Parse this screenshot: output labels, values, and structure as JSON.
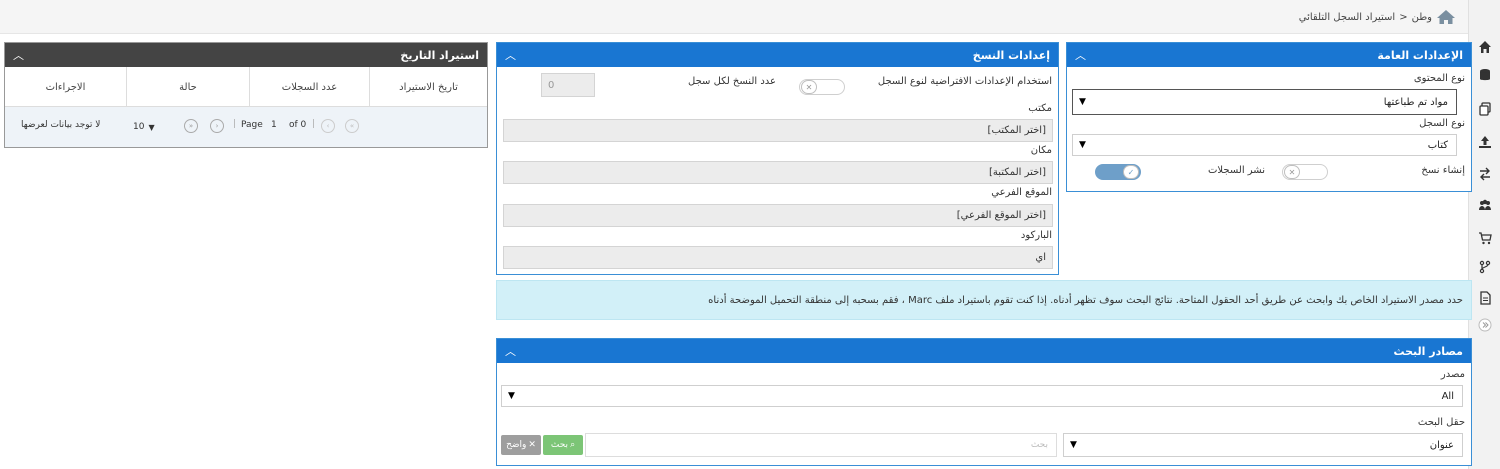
{
  "breadcrumb": {
    "home": "وطن",
    "separator": "<",
    "current": "استيراد السجل التلقائي"
  },
  "sidebar": {
    "icons": [
      "home-icon",
      "database-icon",
      "copy-icon",
      "upload-icon",
      "transfer-icon",
      "users-icon",
      "cart-icon",
      "branch-icon",
      "document-icon",
      "expand-icon"
    ]
  },
  "general": {
    "title": "الإعدادات العامة",
    "content_type_label": "نوع المحتوى",
    "content_type_value": "مواد تم طباعتها",
    "record_type_label": "نوع السجل",
    "record_type_value": "كتاب",
    "create_copies_label": "إنشاء نسخ",
    "publish_records_label": "نشر السجلات",
    "create_copies_on": true,
    "publish_records_on": false
  },
  "copy": {
    "title": "إعدادات النسخ",
    "use_default_label": "استخدام الإعدادات الافتراضية لنوع السجل",
    "copies_per_record_label": "عدد النسخ لكل سجل",
    "copies_per_record_value": "0",
    "library_label": "مكتب",
    "library_value": "[اختر المكتب]",
    "location_label": "مكان",
    "location_value": "[اختر المكتبة]",
    "sublocation_label": "الموقع الفرعي",
    "sublocation_value": "[اختر الموقع الفرعي]",
    "barcode_label": "الباركود",
    "barcode_value": "اي"
  },
  "history": {
    "title": "استيراد التاريخ",
    "columns": [
      "تاريخ الاستيراد",
      "عدد السجلات",
      "حالة",
      "الاجراءات"
    ],
    "no_data": "لا توجد بيانات لعرضها",
    "page_label": "Page",
    "page_value": "1",
    "of_label": "of 0",
    "page_size": "10"
  },
  "info": {
    "text": "حدد مصدر الاستيراد الخاص بك وابحث عن طريق أحد الحقول المتاحة. نتائج البحث سوف تظهر أدناه. إذا كنت تقوم باستيراد ملف Marc ، فقم بسحبه إلى منطقة التحميل الموضحة أدناه"
  },
  "sources": {
    "title": "مصادر البحث",
    "source_label": "مصدر",
    "source_value": "All",
    "field_label": "حقل البحث",
    "field_value": "عنوان",
    "search_placeholder": "بحث",
    "search_button": "بحث",
    "clear_button": "واضح"
  },
  "colors": {
    "panel_blue": "#1976d2",
    "panel_dark": "#444444",
    "info_bg": "#d2f0f8",
    "search_green": "#7cc576",
    "clear_grey": "#9e9e9e"
  }
}
